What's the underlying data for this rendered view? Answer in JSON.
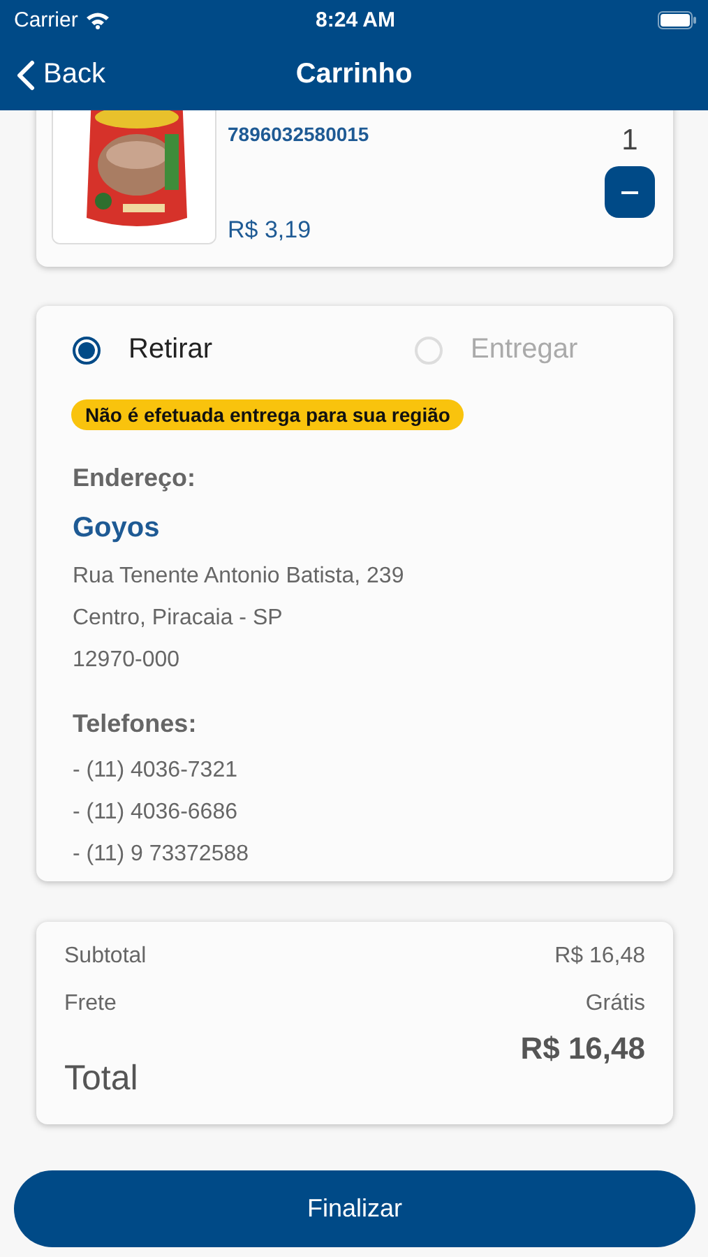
{
  "status_bar": {
    "carrier": "Carrier",
    "time": "8:24 AM"
  },
  "nav": {
    "back": "Back",
    "title": "Carrinho"
  },
  "product": {
    "code": "7896032580015",
    "quantity": "1",
    "price": "R$ 3,19"
  },
  "delivery_options": [
    {
      "label": "Retirar",
      "selected": true,
      "disabled": false
    },
    {
      "label": "Entregar",
      "selected": false,
      "disabled": true
    }
  ],
  "notice": "Não é efetuada entrega para sua região",
  "address": {
    "heading": "Endereço:",
    "name": "Goyos",
    "lines": [
      "Rua Tenente Antonio Batista, 239",
      "Centro, Piracaia - SP",
      "12970-000"
    ]
  },
  "phones": {
    "heading": "Telefones:",
    "lines": [
      "- (11) 4036-7321",
      "- (11) 4036-6686",
      "- (11) 9 73372588"
    ]
  },
  "summary": {
    "rows": [
      {
        "label": "Subtotal",
        "value": "R$ 16,48"
      },
      {
        "label": "Frete",
        "value": "Grátis"
      }
    ],
    "total_label": "Total",
    "total_value": "R$ 16,48"
  },
  "finish_button": "Finalizar"
}
